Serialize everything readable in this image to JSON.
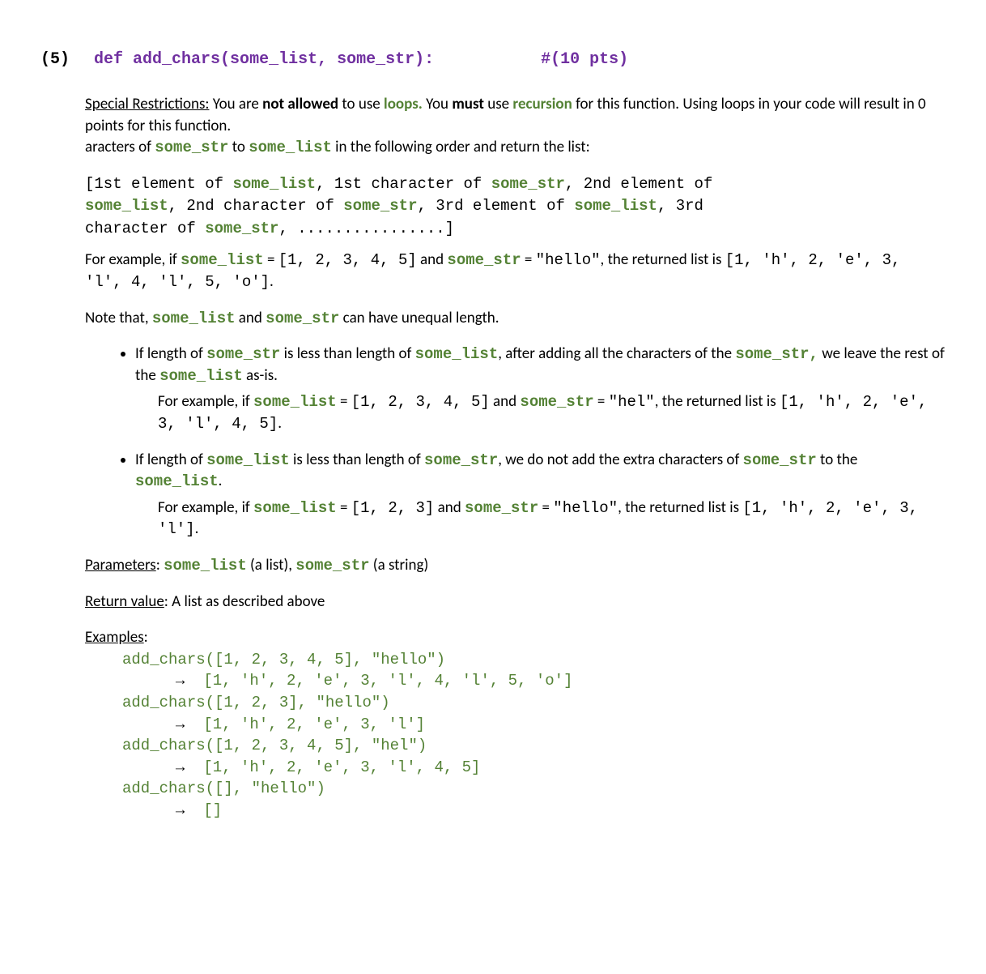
{
  "heading": {
    "q_num": "(5)",
    "signature": "def add_chars(some_list, some_str):",
    "pts": "#(10 pts)"
  },
  "restrictions": {
    "label": "Special Restrictions:",
    "t1": " You are ",
    "not_allowed": "not allowed",
    "t2": " to use ",
    "loops": "loops.",
    "t3": " You ",
    "must": "must",
    "t4": " use ",
    "recursion": "recursion",
    "t5": " for this function. Using loops in your code will result in 0 points for this function."
  },
  "intro_line": {
    "t1": "aracters of ",
    "code1": "some_str",
    "t2": " to ",
    "code2": "some_list",
    "t3": " in the following order and return the list:"
  },
  "interleave": {
    "line1_a": "[1st element of ",
    "line1_b": "some_list",
    "line1_c": ", 1st character of ",
    "line1_d": "some_str",
    "line1_e": ", 2nd element of",
    "line2_a": "some_list",
    "line2_b": ", 2nd character of ",
    "line2_c": "some_str",
    "line2_d": ", 3rd element of ",
    "line2_e": "some_list",
    "line2_f": ", 3rd",
    "line3_a": "character of ",
    "line3_b": "some_str",
    "line3_c": ", ................]"
  },
  "example_main": {
    "t1": "For example, if ",
    "code1": "some_list",
    "t2": " = ",
    "val1": "[1, 2, 3, 4, 5]",
    "t3": " and ",
    "code2": "some_str",
    "t4": " = ",
    "val2": "\"hello\"",
    "t5": ", the returned list is ",
    "result": "[1, 'h', 2, 'e', 3, 'l', 4, 'l', 5, 'o']",
    "t6": "."
  },
  "note": {
    "t1": "Note that, ",
    "code1": "some_list",
    "t2": " and ",
    "code2": "some_str",
    "t3": " can have unequal length."
  },
  "bullet1": {
    "t1": "If length of ",
    "code1": "some_str",
    "t2": " is less than length of ",
    "code2": "some_list",
    "t3": ", after adding all the characters of the ",
    "code3": "some_str,",
    "t4": " we leave the rest of the ",
    "code4": "some_list",
    "t5": " as-is.",
    "ex_t1": "For example, if ",
    "ex_code1": "some_list",
    "ex_t2": " = ",
    "ex_val1": "[1, 2, 3, 4, 5]",
    "ex_t3": " and ",
    "ex_code2": "some_str",
    "ex_t4": " = ",
    "ex_val2": "\"hel\"",
    "ex_t5": ", the returned list is ",
    "ex_result": "[1, 'h', 2, 'e', 3, 'l', 4, 5]",
    "ex_t6": "."
  },
  "bullet2": {
    "t1": "If length of ",
    "code1": "some_list",
    "t2": " is less than length of ",
    "code2": "some_str",
    "t3": ", we do not add the extra characters of ",
    "code3": "some_str",
    "t4": " to the ",
    "code4": "some_list",
    "t5": ".",
    "ex_t1": "For example, if ",
    "ex_code1": "some_list",
    "ex_t2": " = ",
    "ex_val1": "[1, 2, 3]",
    "ex_t3": " and ",
    "ex_code2": "some_str",
    "ex_t4": " = ",
    "ex_val2": "\"hello\"",
    "ex_t5": ", the returned list is ",
    "ex_result": "[1, 'h', 2, 'e', 3, 'l']",
    "ex_t6": "."
  },
  "params": {
    "label": "Parameters",
    "t1": ": ",
    "code1": "some_list",
    "t2": " (a list), ",
    "code2": "some_str",
    "t3": " (a string)"
  },
  "return_val": {
    "label": "Return value",
    "t1": ": A list as described above"
  },
  "examples": {
    "label": "Examples",
    "t1": ":",
    "items": [
      {
        "call": "add_chars([1, 2, 3, 4, 5], \"hello\")",
        "arrow": "→",
        "result": "[1, 'h', 2, 'e', 3, 'l', 4, 'l', 5, 'o']"
      },
      {
        "call": "add_chars([1, 2, 3], \"hello\")",
        "arrow": "→",
        "result": "[1, 'h', 2, 'e', 3, 'l']"
      },
      {
        "call": "add_chars([1, 2, 3, 4, 5], \"hel\")",
        "arrow": "→",
        "result": "[1, 'h', 2, 'e', 3, 'l', 4, 5]"
      },
      {
        "call": "add_chars([], \"hello\")",
        "arrow": "→",
        "result": "[]"
      }
    ]
  }
}
